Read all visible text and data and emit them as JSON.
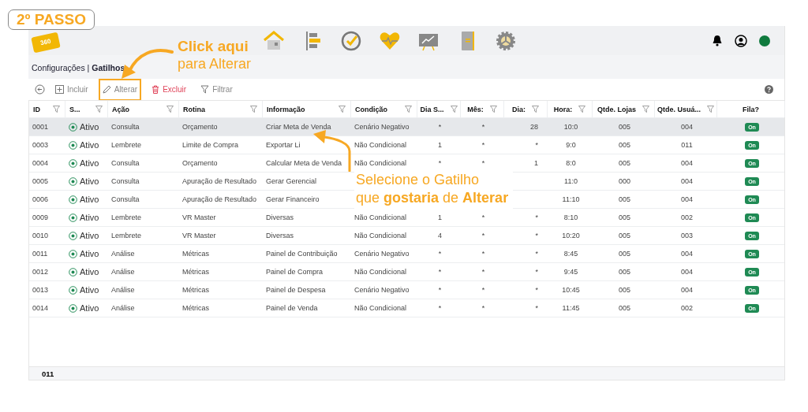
{
  "step_badge": "2º PASSO",
  "logo": "360",
  "breadcrumb": "Configurações | **Gatilhos**",
  "toolbar": {
    "buttons": [
      {
        "label": "Incluir",
        "kind": "add",
        "highlighted": false
      },
      {
        "label": "Alterar",
        "kind": "edit",
        "highlighted": true
      },
      {
        "label": "Excluir",
        "kind": "delete",
        "highlighted": false
      },
      {
        "label": "Filtrar",
        "kind": "filter",
        "highlighted": false
      }
    ]
  },
  "table": {
    "columns": [
      {
        "label": "ID",
        "kind": "text",
        "filter": true
      },
      {
        "label": "S...",
        "kind": "status",
        "filter": true
      },
      {
        "label": "Ação",
        "kind": "text",
        "filter": true
      },
      {
        "label": "Rotina",
        "kind": "text",
        "filter": true
      },
      {
        "label": "Informação",
        "kind": "text",
        "filter": true
      },
      {
        "label": "Condição",
        "kind": "text",
        "filter": true
      },
      {
        "label": "Dia S...",
        "kind": "center",
        "filter": true
      },
      {
        "label": "Mês:",
        "kind": "center",
        "filter": true
      },
      {
        "label": "Dia:",
        "kind": "right",
        "filter": true
      },
      {
        "label": "Hora:",
        "kind": "center",
        "filter": true
      },
      {
        "label": "Qtde. Lojas",
        "kind": "center",
        "filter": true
      },
      {
        "label": "Qtde. Usuá...",
        "kind": "center",
        "filter": true
      },
      {
        "label": "Fila?",
        "kind": "badge",
        "filter": false
      }
    ],
    "rows": [
      {
        "selected": true,
        "cells": [
          "0001",
          "Ativo",
          "Consulta",
          "Orçamento",
          "Criar Meta de Venda",
          "Cenário Negativo",
          "*",
          "*",
          "28",
          "10:0",
          "005",
          "004",
          "On"
        ]
      },
      {
        "selected": false,
        "cells": [
          "0003",
          "Ativo",
          "Lembrete",
          "Limite de Compra",
          "Exportar Li",
          "Não Condicional",
          "1",
          "*",
          "*",
          "9:0",
          "005",
          "011",
          "On"
        ]
      },
      {
        "selected": false,
        "cells": [
          "0004",
          "Ativo",
          "Consulta",
          "Orçamento",
          "Calcular Meta de Venda",
          "Não Condicional",
          "*",
          "*",
          "1",
          "8:0",
          "005",
          "004",
          "On"
        ]
      },
      {
        "selected": false,
        "cells": [
          "0005",
          "Ativo",
          "Consulta",
          "Apuração de Resultado",
          "Gerar Gerencial",
          null,
          null,
          null,
          null,
          "11:0",
          "000",
          "004",
          "On"
        ]
      },
      {
        "selected": false,
        "cells": [
          "0006",
          "Ativo",
          "Consulta",
          "Apuração de Resultado",
          "Gerar Financeiro",
          null,
          null,
          null,
          null,
          "11:10",
          "005",
          "004",
          "On"
        ]
      },
      {
        "selected": false,
        "cells": [
          "0009",
          "Ativo",
          "Lembrete",
          "VR Master",
          "Diversas",
          "Não Condicional",
          "1",
          "*",
          "*",
          "8:10",
          "005",
          "002",
          "On"
        ]
      },
      {
        "selected": false,
        "cells": [
          "0010",
          "Ativo",
          "Lembrete",
          "VR Master",
          "Diversas",
          "Não Condicional",
          "4",
          "*",
          "*",
          "10:20",
          "005",
          "003",
          "On"
        ]
      },
      {
        "selected": false,
        "cells": [
          "0011",
          "Ativo",
          "Análise",
          "Métricas",
          "Painel de Contribuição",
          "Cenário Negativo",
          "*",
          "*",
          "*",
          "8:45",
          "005",
          "004",
          "On"
        ]
      },
      {
        "selected": false,
        "cells": [
          "0012",
          "Ativo",
          "Análise",
          "Métricas",
          "Painel de Compra",
          "Não Condicional",
          "*",
          "*",
          "*",
          "9:45",
          "005",
          "004",
          "On"
        ]
      },
      {
        "selected": false,
        "cells": [
          "0013",
          "Ativo",
          "Análise",
          "Métricas",
          "Painel de Despesa",
          "Cenário Negativo",
          "*",
          "*",
          "*",
          "10:45",
          "005",
          "004",
          "On"
        ]
      },
      {
        "selected": false,
        "cells": [
          "0014",
          "Ativo",
          "Análise",
          "Métricas",
          "Painel de Venda",
          "Não Condicional",
          "*",
          "*",
          "*",
          "11:45",
          "005",
          "002",
          "On"
        ]
      }
    ],
    "footer": "011"
  },
  "click_hint": {
    "title": "Click aqui",
    "subtitle": "para Alterar"
  },
  "select_hint": [
    "Selecione o Gatilho",
    "que **gostaria** de **Alterar**"
  ]
}
